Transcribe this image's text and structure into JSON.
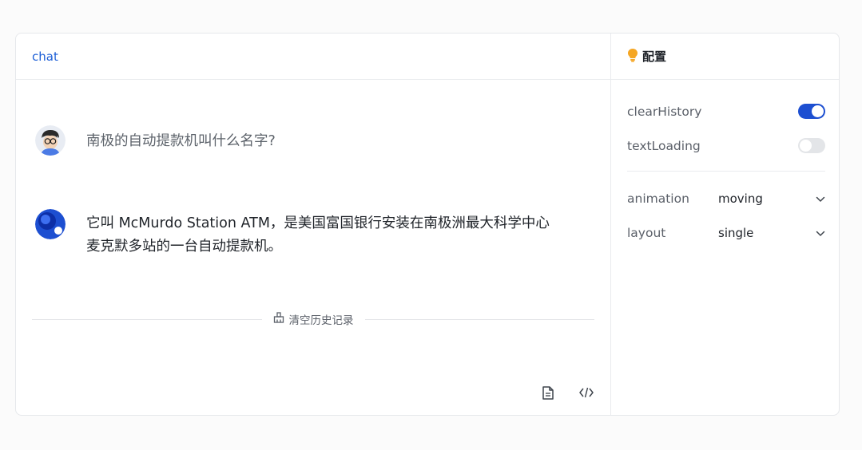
{
  "chat": {
    "title": "chat",
    "messages": [
      {
        "role": "user",
        "text": "南极的自动提款机叫什么名字?"
      },
      {
        "role": "assistant",
        "text": "它叫 McMurdo Station ATM，是美国富国银行安装在南极洲最大科学中心麦克默多站的一台自动提款机。"
      }
    ],
    "clear_label": "清空历史记录",
    "icons": {
      "copy": "copy-icon",
      "code": "code-icon",
      "clear": "broom-icon"
    }
  },
  "config": {
    "title": "配置",
    "title_icon": "lightbulb-icon",
    "toggles": [
      {
        "label": "clearHistory",
        "on": true
      },
      {
        "label": "textLoading",
        "on": false
      }
    ],
    "selects": [
      {
        "label": "animation",
        "value": "moving"
      },
      {
        "label": "layout",
        "value": "single"
      }
    ]
  },
  "colors": {
    "accent": "#1d4fd1",
    "title_link": "#1d5fd6",
    "bulb": "#f5a623"
  }
}
